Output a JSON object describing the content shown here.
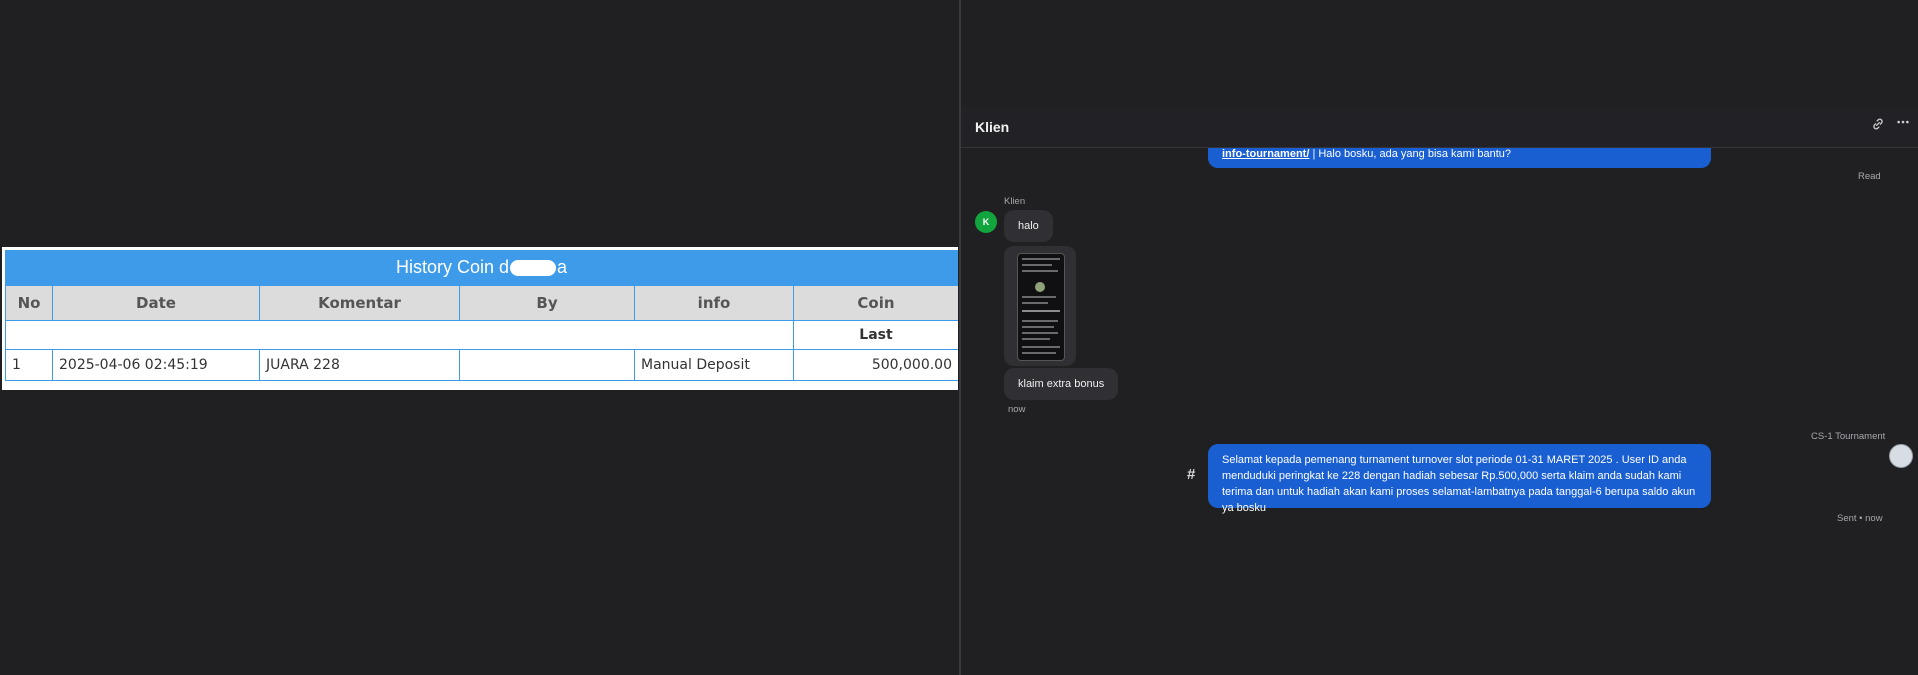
{
  "history": {
    "title_prefix": "History Coin d",
    "title_suffix": "a",
    "columns": [
      "No",
      "Date",
      "Komentar",
      "By",
      "info",
      "Coin"
    ],
    "subheader_last": "Last",
    "rows": [
      {
        "no": "1",
        "date": "2025-04-06 02:45:19",
        "komentar": "JUARA 228",
        "by": "",
        "info": "Manual Deposit",
        "coin": "500,000.00"
      }
    ]
  },
  "chat": {
    "title": "Klien",
    "header_icons": [
      "link-icon",
      "more-icon"
    ],
    "messages": {
      "prev_out": {
        "link_text": "info-tournament/",
        "text": " | Halo bosku, ada yang bisa kami bantu?",
        "status": "Read"
      },
      "client_name": "Klien",
      "client_avatar_letter": "K",
      "in_1": "halo",
      "in_2": "klaim extra bonus",
      "in_time": "now",
      "agent_name": "CS-1 Tournament",
      "out_1": "Selamat kepada pemenang turnament turnover slot periode 01-31 MARET 2025 . User ID anda menduduki peringkat ke 228 dengan hadiah sebesar Rp.500,000 serta klaim anda sudah kami terima dan untuk hadiah akan kami proses selamat-lambatnya pada tanggal-6 berupa saldo akun ya bosku",
      "out_1_status": "Sent • now",
      "hash": "#"
    }
  }
}
